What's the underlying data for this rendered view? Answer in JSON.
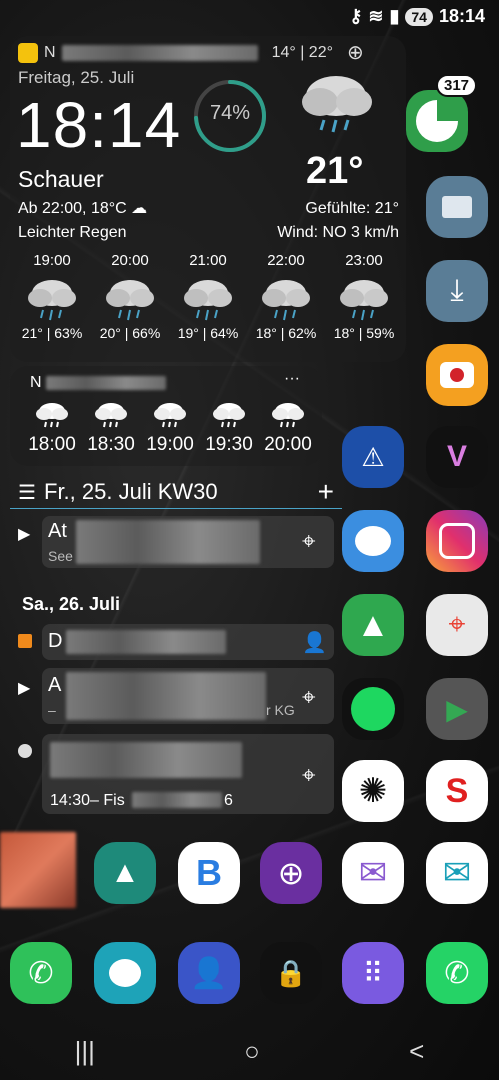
{
  "status": {
    "battery": "74",
    "time": "18:14"
  },
  "weather": {
    "location_label": "N",
    "temp_range": "14° | 22°",
    "date": "Freitag, 25. Juli",
    "time": "18:14",
    "humidity": "74%",
    "humidity_fraction": 0.74,
    "temperature": "21°",
    "condition": "Schauer",
    "from": "Ab 22:00, 18°C",
    "rain": "Leichter Regen",
    "feels": "Gefühlte: 21°",
    "wind": "Wind: NO 3 km/h",
    "hours": [
      {
        "time": "19:00",
        "info": "21° | 63%"
      },
      {
        "time": "20:00",
        "info": "20° | 66%"
      },
      {
        "time": "21:00",
        "info": "19° | 64%"
      },
      {
        "time": "22:00",
        "info": "18° | 62%"
      },
      {
        "time": "23:00",
        "info": "18° | 59%"
      }
    ]
  },
  "weather2": {
    "title": "N",
    "more": "···",
    "times": [
      "18:00",
      "18:30",
      "19:00",
      "19:30",
      "20:00"
    ]
  },
  "calendar": {
    "header": "Fr., 25. Juli KW30",
    "add": "+",
    "events": [
      {
        "title": "At",
        "sub": "See"
      },
      {
        "title": "D",
        "sub": ""
      },
      {
        "title": "A",
        "sub": "–",
        "sub_end": "r KG"
      },
      {
        "title": "",
        "sub": "14:30– Fis",
        "sub_end": "6"
      }
    ],
    "day2": "Sa., 26. Juli"
  },
  "apps": {
    "notification_count": "317"
  },
  "nav": {
    "recents": "|||",
    "home": "○",
    "back": "<"
  },
  "colors": {
    "accent": "#4aa3c7",
    "ring": "#2f9e8a",
    "orange": "#f08a1c"
  }
}
